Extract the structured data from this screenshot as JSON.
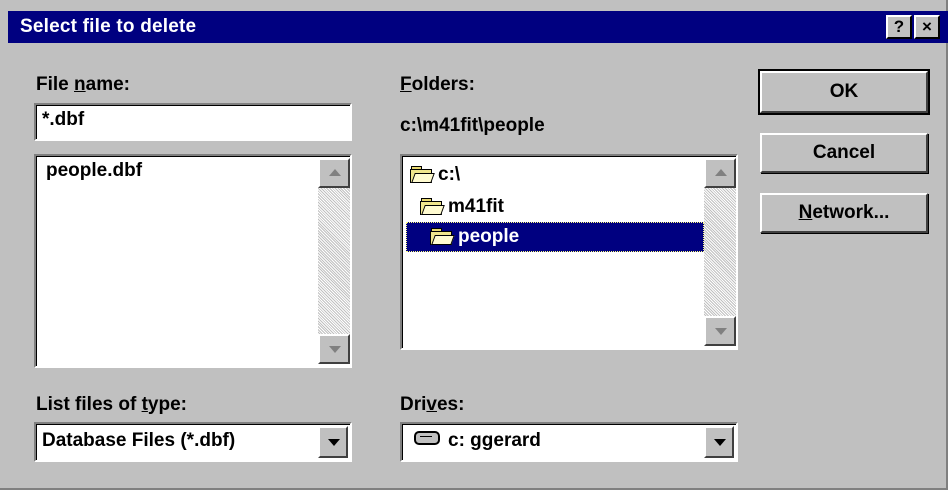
{
  "window": {
    "title": "Select file to delete",
    "help_glyph": "?",
    "close_glyph": "×"
  },
  "file_name": {
    "label_pre": "File ",
    "label_accel": "n",
    "label_post": "ame:",
    "value": "*.dbf"
  },
  "files": {
    "items": [
      "people.dbf"
    ]
  },
  "folders": {
    "label_accel": "F",
    "label_post": "olders:",
    "current_path": "c:\\m41fit\\people",
    "items": [
      {
        "name": "c:\\",
        "selected": false
      },
      {
        "name": "m41fit",
        "selected": false
      },
      {
        "name": "people",
        "selected": true
      }
    ]
  },
  "file_type": {
    "label_pre": "List files of ",
    "label_accel": "t",
    "label_post": "ype:",
    "value": "Database Files (*.dbf)"
  },
  "drives": {
    "label_pre": "Dri",
    "label_accel": "v",
    "label_post": "es:",
    "value": "c: ggerard"
  },
  "buttons": {
    "ok": "OK",
    "cancel": "Cancel",
    "network_accel": "N",
    "network_post": "etwork..."
  },
  "colors": {
    "titlebar": "#000080",
    "face": "#c0c0c0",
    "selection": "#000080"
  }
}
